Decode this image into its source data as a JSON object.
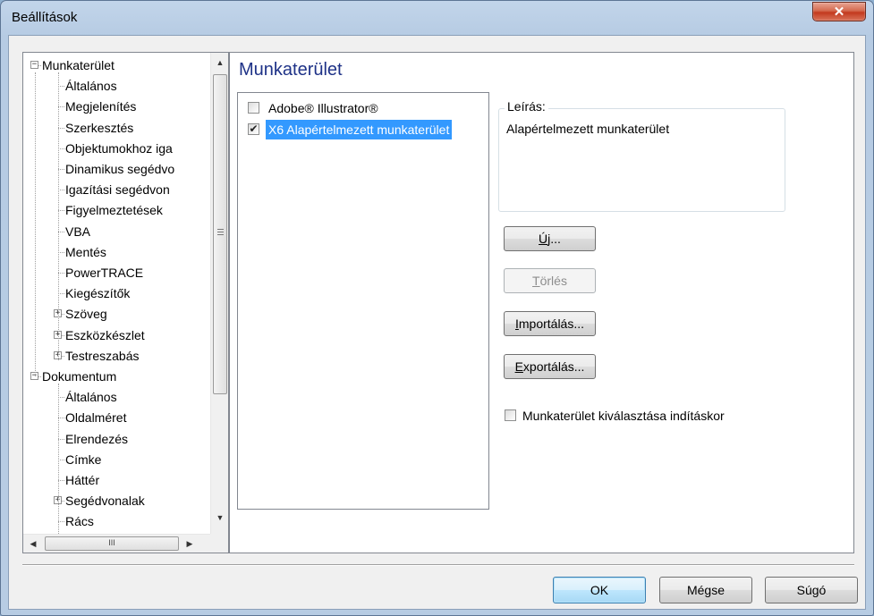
{
  "window": {
    "title": "Beállítások",
    "close_glyph": "✕"
  },
  "tree": {
    "items": [
      {
        "label": "Munkaterület",
        "level": 0,
        "expander": "−"
      },
      {
        "label": "Általános",
        "level": 1
      },
      {
        "label": "Megjelenítés",
        "level": 1
      },
      {
        "label": "Szerkesztés",
        "level": 1
      },
      {
        "label": "Objektumokhoz iga",
        "level": 1
      },
      {
        "label": "Dinamikus segédvo",
        "level": 1
      },
      {
        "label": "Igazítási segédvon",
        "level": 1
      },
      {
        "label": "Figyelmeztetések",
        "level": 1
      },
      {
        "label": "VBA",
        "level": 1
      },
      {
        "label": "Mentés",
        "level": 1
      },
      {
        "label": "PowerTRACE",
        "level": 1
      },
      {
        "label": "Kiegészítők",
        "level": 1
      },
      {
        "label": "Szöveg",
        "level": 1,
        "expander": "+"
      },
      {
        "label": "Eszközkészlet",
        "level": 1,
        "expander": "+"
      },
      {
        "label": "Testreszabás",
        "level": 1,
        "expander": "+"
      },
      {
        "label": "Dokumentum",
        "level": 0,
        "expander": "−"
      },
      {
        "label": "Általános",
        "level": 1
      },
      {
        "label": "Oldalméret",
        "level": 1
      },
      {
        "label": "Elrendezés",
        "level": 1
      },
      {
        "label": "Címke",
        "level": 1
      },
      {
        "label": "Háttér",
        "level": 1
      },
      {
        "label": "Segédvonalak",
        "level": 1,
        "expander": "+"
      },
      {
        "label": "Rács",
        "level": 1
      }
    ],
    "hscroll_grip": "III"
  },
  "panel": {
    "title": "Munkaterület",
    "workspaces": [
      {
        "label": "Adobe® Illustrator®",
        "checked": false,
        "selected": false
      },
      {
        "label": "X6 Alapértelmezett munkaterület",
        "checked": true,
        "selected": true
      }
    ],
    "description": {
      "legend": "Leírás:",
      "text": "Alapértelmezett munkaterület"
    },
    "buttons": {
      "new": {
        "mnemonic": "Ú",
        "rest": "j..."
      },
      "delete": {
        "mnemonic": "T",
        "rest": "örlés"
      },
      "import": {
        "mnemonic": "I",
        "rest": "mportálás..."
      },
      "export": {
        "mnemonic": "E",
        "rest": "xportálás..."
      }
    },
    "startup_checkbox": {
      "label": "Munkaterület kiválasztása indításkor",
      "checked": false
    }
  },
  "footer": {
    "ok": "OK",
    "cancel": "Mégse",
    "help": "Súgó"
  }
}
